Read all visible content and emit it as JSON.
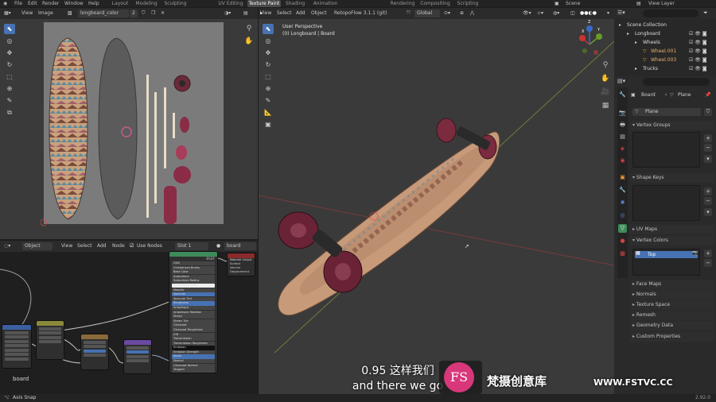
{
  "menu": {
    "items": [
      "File",
      "Edit",
      "Render",
      "Window",
      "Help"
    ]
  },
  "workspaces": {
    "tabs": [
      "Layout",
      "Modeling",
      "Sculpting",
      "UV Editing",
      "Texture Paint",
      "Shading",
      "Animation",
      "Rendering",
      "Compositing",
      "Scripting"
    ]
  },
  "top_right": {
    "scene": "Scene",
    "view_layer": "View Layer"
  },
  "image_editor": {
    "view": "View",
    "image": "Image",
    "image_name": "longboard_color",
    "users": "2"
  },
  "viewport": {
    "menu": [
      "View",
      "Select",
      "Add",
      "Object"
    ],
    "addon": "RetopoFlow 3.1.1 (git)",
    "orientation": "Global",
    "mode_title": "User Perspective",
    "object_info": "(0) Longboard | Board",
    "axis_x": "X",
    "axis_y": "Y",
    "axis_z": "Z"
  },
  "node_editor": {
    "mode": "Object",
    "menu": [
      "View",
      "Select",
      "Add",
      "Node"
    ],
    "use_nodes": "Use Nodes",
    "slot": "Slot 1",
    "material": "board",
    "frame_label": "board",
    "bsdf_title": "BSDF",
    "output_title": "Material Output",
    "output_sockets": [
      "Surface",
      "Volume",
      "Displacement"
    ],
    "bsdf_rows": [
      "GGX",
      "Christensen-Burley",
      "Base Color",
      "Subsurface",
      "Subsurface Radius",
      "Subsurface Color",
      "Metallic",
      "Specular",
      "Specular Tint",
      "Roughness",
      "Anisotropic",
      "Anisotropic Rotation",
      "Sheen",
      "Sheen Tint",
      "Clearcoat",
      "Clearcoat Roughness",
      "IOR",
      "Transmission",
      "Transmission Roughness",
      "Emission",
      "Emission Strength",
      "Alpha",
      "Normal",
      "Clearcoat Normal",
      "Tangent"
    ]
  },
  "outliner": {
    "items": [
      {
        "label": "Scene Collection",
        "indent": 0
      },
      {
        "label": "Longboard",
        "indent": 1
      },
      {
        "label": "Wheels",
        "indent": 2
      },
      {
        "label": "Wheel.001",
        "indent": 3
      },
      {
        "label": "Wheel.003",
        "indent": 3
      },
      {
        "label": "Trucks",
        "indent": 2
      }
    ]
  },
  "properties": {
    "object": "Board",
    "mesh": "Plane",
    "data_name": "Plane",
    "sections": [
      "Vertex Groups",
      "Shape Keys",
      "UV Maps",
      "Vertex Colors",
      "Face Maps",
      "Normals",
      "Texture Space",
      "Remesh",
      "Geometry Data",
      "Custom Properties"
    ],
    "vertex_color_item": "Top"
  },
  "subtitles": {
    "line_cn": "0.95 这样我们",
    "line_en": "and there we go"
  },
  "watermark": {
    "brand": "梵摄创意库",
    "url": "WWW.FSTVC.CC",
    "logo_letters": "FS"
  },
  "status": {
    "left": "Axis Snap",
    "version": "2.92.0"
  },
  "colors": {
    "accent": "#4772b3",
    "bg": "#1d1d1d",
    "panel": "#2b2b2b",
    "wheel": "#7a2b3e"
  }
}
